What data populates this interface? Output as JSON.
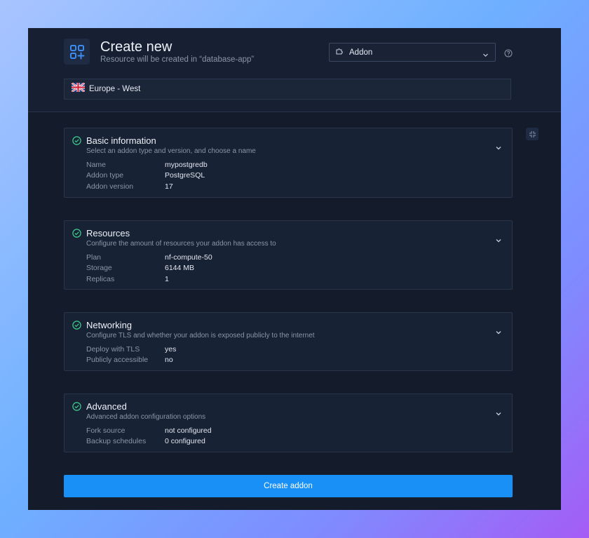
{
  "header": {
    "title": "Create new",
    "subtitle": "Resource will be created in “database-app”",
    "type_select": {
      "value": "Addon"
    },
    "region": "Europe - West"
  },
  "cards": [
    {
      "title": "Basic information",
      "description": "Select an addon type and version, and choose a name",
      "rows": [
        {
          "key": "Name",
          "value": "mypostgredb"
        },
        {
          "key": "Addon type",
          "value": "PostgreSQL"
        },
        {
          "key": "Addon version",
          "value": "17"
        }
      ]
    },
    {
      "title": "Resources",
      "description": "Configure the amount of resources your addon has access to",
      "rows": [
        {
          "key": "Plan",
          "value": "nf-compute-50"
        },
        {
          "key": "Storage",
          "value": "6144 MB"
        },
        {
          "key": "Replicas",
          "value": "1"
        }
      ]
    },
    {
      "title": "Networking",
      "description": "Configure TLS and whether your addon is exposed publicly to the internet",
      "rows": [
        {
          "key": "Deploy with TLS",
          "value": "yes"
        },
        {
          "key": "Publicly accessible",
          "value": "no"
        }
      ]
    },
    {
      "title": "Advanced",
      "description": "Advanced addon configuration options",
      "rows": [
        {
          "key": "Fork source",
          "value": "not configured"
        },
        {
          "key": "Backup schedules",
          "value": "0 configured"
        }
      ]
    }
  ],
  "submit_label": "Create addon",
  "icons": {
    "app": "grid-plus-icon",
    "type_select": "puzzle-icon",
    "help": "help-circle-icon",
    "region_flag": "uk-flag-icon",
    "collapse_all": "collapse-icon",
    "card_status": "check-circle-icon",
    "card_toggle": "chevron-down-icon"
  },
  "colors": {
    "accent": "#1890f5",
    "success": "#3ecf8e",
    "background": "#141c2b",
    "card": "#182235"
  }
}
